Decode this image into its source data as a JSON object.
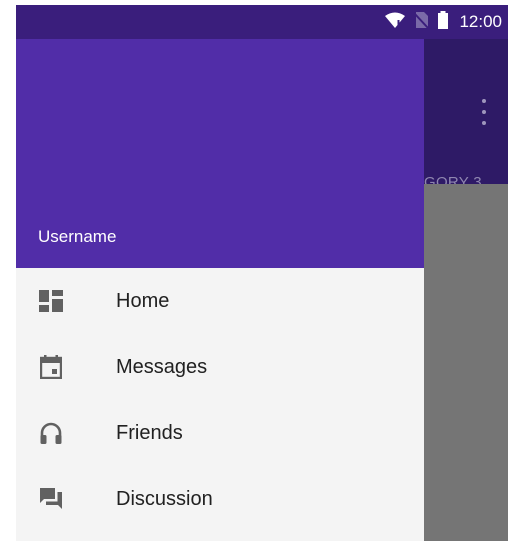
{
  "status_bar": {
    "time": "12:00",
    "icons": [
      "wifi-icon",
      "no-sim-icon",
      "battery-icon"
    ]
  },
  "app_bar": {
    "tab_label": "GORY 3",
    "overflow_icon": "more-vert-icon"
  },
  "drawer": {
    "header": {
      "username": "Username",
      "background": "#512da8"
    },
    "items": [
      {
        "label": "Home",
        "icon": "dashboard-icon"
      },
      {
        "label": "Messages",
        "icon": "event-icon"
      },
      {
        "label": "Friends",
        "icon": "headset-icon"
      },
      {
        "label": "Discussion",
        "icon": "forum-icon"
      }
    ]
  },
  "colors": {
    "status_bar": "#3a1e7c",
    "app_bar": "#2e1a66",
    "drawer_header": "#512da8",
    "drawer_body": "#f4f4f4",
    "scrim": "#757575",
    "icon": "#616161"
  }
}
